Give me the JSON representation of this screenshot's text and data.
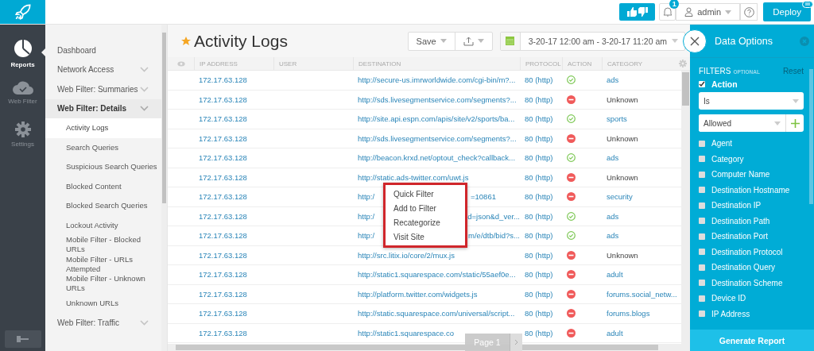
{
  "rail": [
    {
      "label": "Reports",
      "kind": "pie",
      "selected": true
    },
    {
      "label": "Web Filter",
      "kind": "cloud",
      "selected": false
    },
    {
      "label": "Settings",
      "kind": "gear",
      "selected": false
    }
  ],
  "topbar": {
    "notifications": "1",
    "user": "admin",
    "deploy": "Deploy"
  },
  "nav": [
    {
      "label": "Dashboard",
      "kind": "link",
      "selected": false
    },
    {
      "label": "Network Access",
      "kind": "group",
      "expanded": false,
      "selected": false
    },
    {
      "label": "Web Filter: Summaries",
      "kind": "group",
      "expanded": false,
      "selected": false
    },
    {
      "label": "Web Filter: Details",
      "kind": "group",
      "expanded": true,
      "selected": false,
      "children": [
        {
          "label": "Activity Logs",
          "selected": true
        },
        {
          "label": "Search Queries",
          "selected": false
        },
        {
          "label": "Suspicious Search Queries",
          "selected": false
        },
        {
          "label": "Blocked Content",
          "selected": false
        },
        {
          "label": "Blocked Search Queries",
          "selected": false
        },
        {
          "label": "Lockout Activity",
          "selected": false
        },
        {
          "label": "Mobile Filter - Blocked URLs",
          "selected": false
        },
        {
          "label": "Mobile Filter - URLs Attempted",
          "selected": false
        },
        {
          "label": "Mobile Filter - Unknown URLs",
          "selected": false
        },
        {
          "label": "Unknown URLs",
          "selected": false
        }
      ]
    },
    {
      "label": "Web Filter: Traffic",
      "kind": "group",
      "expanded": false,
      "selected": false
    }
  ],
  "page": {
    "title": "Activity Logs",
    "favorite": true,
    "save": "Save",
    "date_range": "3-20-17 12:00 am - 3-20-17 11:20 am"
  },
  "table": {
    "columns": [
      "IP ADDRESS",
      "USER",
      "DESTINATION",
      "PROTOCOL",
      "ACTION",
      "CATEGORY"
    ],
    "rows": [
      {
        "ip": "172.17.63.128",
        "destination": "http://secure-us.imrworldwide.com/cgi-bin/m?...",
        "protocol": "80 (http)",
        "allowed": true,
        "category": "ads",
        "category_link": true
      },
      {
        "ip": "172.17.63.128",
        "destination": "http://sds.livesegmentservice.com/segments?...",
        "protocol": "80 (http)",
        "allowed": false,
        "category": "Unknown",
        "category_link": false
      },
      {
        "ip": "172.17.63.128",
        "destination": "http://site.api.espn.com/apis/site/v2/sports/ba...",
        "protocol": "80 (http)",
        "allowed": true,
        "category": "sports",
        "category_link": true
      },
      {
        "ip": "172.17.63.128",
        "destination": "http://sds.livesegmentservice.com/segments?...",
        "protocol": "80 (http)",
        "allowed": false,
        "category": "Unknown",
        "category_link": false
      },
      {
        "ip": "172.17.63.128",
        "destination": "http://beacon.krxd.net/optout_check?callback...",
        "protocol": "80 (http)",
        "allowed": true,
        "category": "ads",
        "category_link": true
      },
      {
        "ip": "172.17.63.128",
        "destination": "http://static.ads-twitter.com/uwt.js",
        "protocol": "80 (http)",
        "allowed": false,
        "category": "Unknown",
        "category_link": false
      },
      {
        "ip": "172.17.63.128",
        "destination": "http:/",
        "destination_tail": "=10861",
        "protocol": "80 (http)",
        "allowed": false,
        "category": "security",
        "category_link": true
      },
      {
        "ip": "172.17.63.128",
        "destination": "http:/",
        "destination_tail": "d=json&d_ver...",
        "protocol": "80 (http)",
        "allowed": true,
        "category": "ads",
        "category_link": true
      },
      {
        "ip": "172.17.63.128",
        "destination": "http:/",
        "destination_tail": "m/e/dtb/bid?s...",
        "protocol": "80 (http)",
        "allowed": true,
        "category": "ads",
        "category_link": true
      },
      {
        "ip": "172.17.63.128",
        "destination": "http://src.litix.io/core/2/mux.js",
        "protocol": "80 (http)",
        "allowed": false,
        "category": "Unknown",
        "category_link": false
      },
      {
        "ip": "172.17.63.128",
        "destination": "http://static1.squarespace.com/static/55aef0e...",
        "protocol": "80 (http)",
        "allowed": false,
        "category": "adult",
        "category_link": true
      },
      {
        "ip": "172.17.63.128",
        "destination": "http://platform.twitter.com/widgets.js",
        "protocol": "80 (http)",
        "allowed": false,
        "category": "forums.social_netw...",
        "category_link": true
      },
      {
        "ip": "172.17.63.128",
        "destination": "http://static.squarespace.com/universal/script...",
        "protocol": "80 (http)",
        "allowed": false,
        "category": "forums.blogs",
        "category_link": true
      },
      {
        "ip": "172.17.63.128",
        "destination": "http://static1.squarespace.co",
        "protocol": "80 (http)",
        "allowed": false,
        "category": "adult",
        "category_link": true
      }
    ]
  },
  "context_menu": [
    "Quick Filter",
    "Add to Filter",
    "Recategorize",
    "Visit Site"
  ],
  "pagination": {
    "label": "Page 1"
  },
  "panel": {
    "title": "Data Options",
    "filters": "FILTERS",
    "optional": "OPTIONAL",
    "reset": "Reset",
    "action_filter": {
      "label": "Action",
      "checked": true,
      "operator": "Is",
      "value": "Allowed"
    },
    "fields": [
      {
        "label": "Agent",
        "checked": false
      },
      {
        "label": "Category",
        "checked": false
      },
      {
        "label": "Computer Name",
        "checked": false
      },
      {
        "label": "Destination Hostname",
        "checked": false
      },
      {
        "label": "Destination IP",
        "checked": false
      },
      {
        "label": "Destination Path",
        "checked": false
      },
      {
        "label": "Destination Port",
        "checked": false
      },
      {
        "label": "Destination Protocol",
        "checked": false
      },
      {
        "label": "Destination Query",
        "checked": false
      },
      {
        "label": "Destination Scheme",
        "checked": false
      },
      {
        "label": "Device ID",
        "checked": false
      },
      {
        "label": "IP Address",
        "checked": false
      }
    ],
    "generate": "Generate Report"
  }
}
